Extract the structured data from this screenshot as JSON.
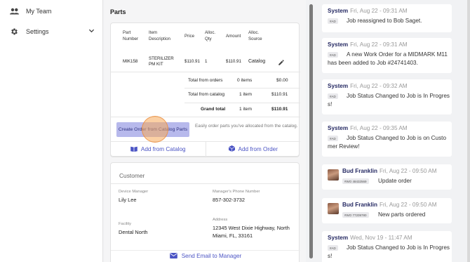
{
  "sidebar": {
    "items": [
      {
        "label": "My Team",
        "icon": "people-icon"
      },
      {
        "label": "Settings",
        "icon": "gear-icon"
      }
    ]
  },
  "parts": {
    "title": "Parts",
    "columns": [
      "Part\nNumber",
      "Item\nDescription",
      "Price",
      "Alloc.\nQty",
      "Amount",
      "Alloc.\nSource"
    ],
    "rows": [
      {
        "part_number": "MIK158",
        "description": "STERILIZER\nPM KIT",
        "price": "$110.91",
        "qty": "1",
        "amount": "$110.91",
        "source": "Catalog"
      }
    ],
    "totals": [
      {
        "label": "Total from orders",
        "items": "0 items",
        "amount": "$0.00"
      },
      {
        "label": "Total from catalog",
        "items": "1 item",
        "amount": "$110.91"
      },
      {
        "label": "Grand total",
        "items": "1 item",
        "amount": "$110.91"
      }
    ],
    "create_button": "Create Order from Catalog Parts",
    "create_help": "Easily order parts you've allocated from the catalog.",
    "add_from_catalog": "Add from Catalog",
    "add_from_order": "Add from Order"
  },
  "customer": {
    "title": "Customer",
    "device_manager_label": "Device Manager",
    "device_manager": "Lily Lee",
    "manager_phone_label": "Manager's Phone Number",
    "manager_phone": "857-302-3732",
    "facility_label": "Facility",
    "facility": "Dental North",
    "address_label": "Address",
    "address": "12345 West Dixie Highway, North Miami, FL, 33161",
    "email_button": "Send Email to Manager"
  },
  "feed": [
    {
      "author": "System",
      "time": "Fri, Aug 22 - 09:31 AM",
      "chip": "#AD",
      "text": "Job reassigned to Bob Saget.",
      "avatar": false
    },
    {
      "author": "System",
      "time": "Fri, Aug 22 - 09:31 AM",
      "chip": "#AD",
      "text": "A new Work Order for a MIDMARK M11 has been added to Job #24741403.",
      "avatar": false
    },
    {
      "author": "System",
      "time": "Fri, Aug 22 - 09:32 AM",
      "chip": "#AD",
      "text": "Job Status Changed to Job is In Progress!",
      "avatar": false
    },
    {
      "author": "System",
      "time": "Fri, Aug 22 - 09:35 AM",
      "chip": "#AD",
      "text": "Job Status Changed to Job is on Customer Review!",
      "avatar": false
    },
    {
      "author": "Bud Franklin",
      "time": "Fri, Aug 22 - 09:50 AM",
      "chip": "#WO 48432569",
      "text": "Update order",
      "avatar": true
    },
    {
      "author": "Bud Franklin",
      "time": "Fri, Aug 22 - 09:50 AM",
      "chip": "#WO 77209780",
      "text": "New parts ordered",
      "avatar": true
    },
    {
      "author": "System",
      "time": "Wed, Nov 19 - 11:47 AM",
      "chip": "#AD",
      "text": "Job Status Changed to Job is In Progress!",
      "avatar": false
    }
  ],
  "colors": {
    "accent": "#4b54c4",
    "button_bg": "#b7b9ec",
    "author": "#262a63",
    "click_marker": "#f7aa5a"
  }
}
